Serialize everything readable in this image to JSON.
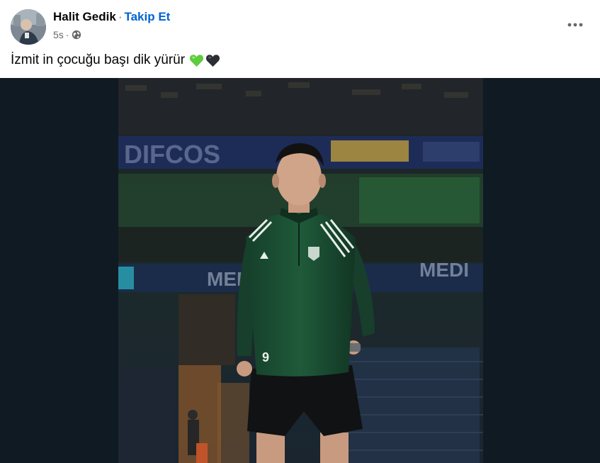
{
  "post": {
    "author": "Halit Gedik",
    "separator": "·",
    "follow_label": "Takip Et",
    "timestamp": "5s",
    "meta_dot": "·",
    "privacy_icon": "globe-icon",
    "more_icon": "more-options-icon",
    "caption": "İzmit in çocuğu başı dik yürür",
    "caption_emojis": [
      "green-heart-icon",
      "black-heart-icon"
    ]
  },
  "photo": {
    "banner_left": "DIFCOS",
    "banner_mid_left": "MEDI",
    "banner_mid_right": "MEDI",
    "jersey_number": "9"
  },
  "colors": {
    "follow_link": "#0064d1",
    "secondary_text": "#65676b",
    "photo_backdrop": "#0f1a22",
    "jersey_green": "#1f5a3a"
  }
}
